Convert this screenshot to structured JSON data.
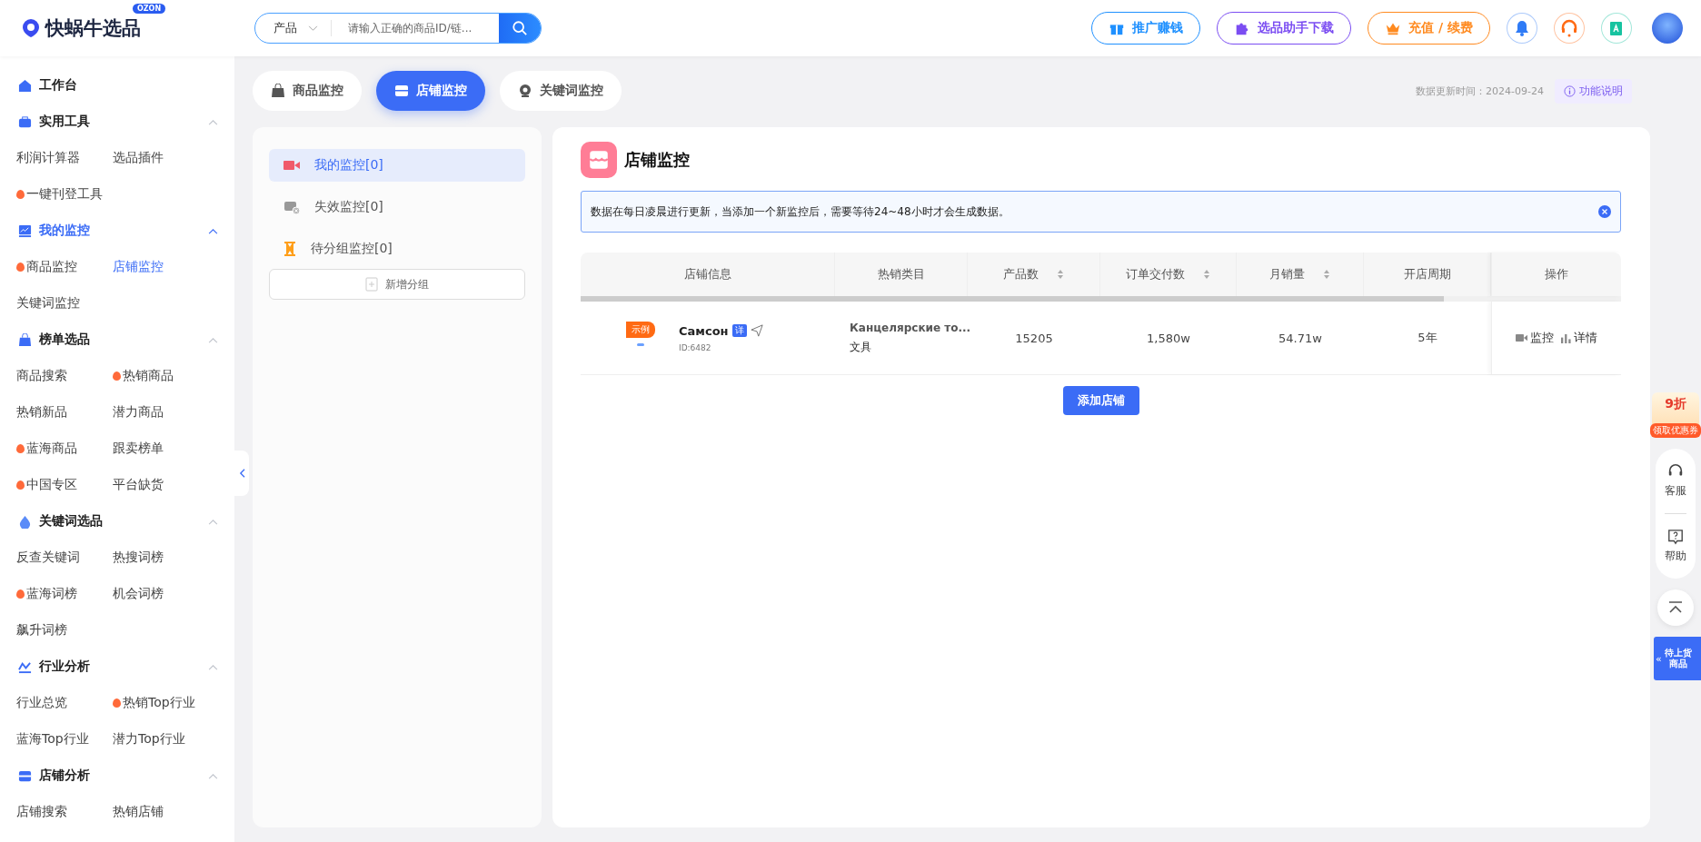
{
  "header": {
    "logo_text": "快蜗牛选品",
    "logo_badge": "OZON",
    "search": {
      "category": "产品",
      "placeholder": "请输入正确的商品ID/链..."
    },
    "buttons": [
      {
        "label": "推广赚钱",
        "kind": "gift",
        "color": "#1e90ff"
      },
      {
        "label": "选品助手下载",
        "kind": "puzzle",
        "color": "#7b4df2"
      },
      {
        "label": "充值 / 续费",
        "kind": "crown",
        "color": "#ff8a1f"
      }
    ],
    "icon_buttons": [
      {
        "kind": "bell",
        "color": "#2f7bf6"
      },
      {
        "kind": "headset",
        "color": "#ff6a13"
      },
      {
        "kind": "translate",
        "color": "#17c3a0"
      }
    ]
  },
  "sidebar": {
    "sections": [
      {
        "title": "工作台",
        "active": false,
        "expanded": false
      },
      {
        "title": "实用工具",
        "active": false,
        "expanded": true,
        "items": [
          {
            "label": "利润计算器",
            "hot": false,
            "selected": false
          },
          {
            "label": "选品插件",
            "hot": false,
            "selected": false
          },
          {
            "label": "一键刊登工具",
            "hot": true,
            "selected": false
          }
        ]
      },
      {
        "title": "我的监控",
        "active": true,
        "expanded": true,
        "items": [
          {
            "label": "商品监控",
            "hot": true,
            "selected": false
          },
          {
            "label": "店铺监控",
            "hot": false,
            "selected": true
          },
          {
            "label": "关键词监控",
            "hot": false,
            "selected": false
          }
        ]
      },
      {
        "title": "榜单选品",
        "active": false,
        "expanded": true,
        "items": [
          {
            "label": "商品搜索",
            "hot": false,
            "selected": false
          },
          {
            "label": "热销商品",
            "hot": true,
            "selected": false
          },
          {
            "label": "热销新品",
            "hot": false,
            "selected": false
          },
          {
            "label": "潜力商品",
            "hot": false,
            "selected": false
          },
          {
            "label": "蓝海商品",
            "hot": true,
            "selected": false
          },
          {
            "label": "跟卖榜单",
            "hot": false,
            "selected": false
          },
          {
            "label": "中国专区",
            "hot": true,
            "selected": false
          },
          {
            "label": "平台缺货",
            "hot": false,
            "selected": false
          }
        ]
      },
      {
        "title": "关键词选品",
        "active": false,
        "expanded": true,
        "items": [
          {
            "label": "反查关键词",
            "hot": false,
            "selected": false
          },
          {
            "label": "热搜词榜",
            "hot": false,
            "selected": false
          },
          {
            "label": "蓝海词榜",
            "hot": true,
            "selected": false
          },
          {
            "label": "机会词榜",
            "hot": false,
            "selected": false
          },
          {
            "label": "飙升词榜",
            "hot": false,
            "selected": false
          }
        ]
      },
      {
        "title": "行业分析",
        "active": false,
        "expanded": true,
        "items": [
          {
            "label": "行业总览",
            "hot": false,
            "selected": false
          },
          {
            "label": "热销Top行业",
            "hot": true,
            "selected": false
          },
          {
            "label": "蓝海Top行业",
            "hot": false,
            "selected": false
          },
          {
            "label": "潜力Top行业",
            "hot": false,
            "selected": false
          }
        ]
      },
      {
        "title": "店铺分析",
        "active": false,
        "expanded": true,
        "items": [
          {
            "label": "店铺搜索",
            "hot": false,
            "selected": false
          },
          {
            "label": "热销店铺",
            "hot": false,
            "selected": false
          }
        ]
      }
    ]
  },
  "tabs": [
    {
      "label": "商品监控",
      "selected": false
    },
    {
      "label": "店铺监控",
      "selected": true
    },
    {
      "label": "关键词监控",
      "selected": false
    }
  ],
  "update_time": "数据更新时间：2024-09-24",
  "help_link": "功能说明",
  "groups": [
    {
      "label": "我的监控[0]",
      "selected": true
    },
    {
      "label": "失效监控[0]",
      "selected": false
    },
    {
      "label": "待分组监控[0]",
      "selected": false
    }
  ],
  "add_group": "新增分组",
  "panel": {
    "title": "店铺监控",
    "notice": "数据在每日凌晨进行更新，当添加一个新监控后，需要等待24~48小时才会生成数据。",
    "columns": [
      {
        "label": "店铺信息",
        "sortable": false
      },
      {
        "label": "热销类目",
        "sortable": false
      },
      {
        "label": "产品数",
        "sortable": true
      },
      {
        "label": "订单交付数",
        "sortable": true
      },
      {
        "label": "月销量",
        "sortable": true
      },
      {
        "label": "开店周期",
        "sortable": false
      },
      {
        "label": "操作",
        "sortable": false
      }
    ],
    "rows": [
      {
        "badge": "示例",
        "name": "Самсон",
        "tag": "详",
        "id": "ID:6482",
        "category": "Канцелярские то...",
        "subcategory": "文具",
        "products": "15205",
        "orders": "1,580w",
        "monthly_sales": "54.71w",
        "store_age": "5年",
        "actions": [
          {
            "label": "监控",
            "kind": "monitor"
          },
          {
            "label": "详情",
            "kind": "detail"
          }
        ]
      }
    ],
    "add_button": "添加店铺"
  },
  "floating": {
    "promo": "9折",
    "promo_caption": "领取优惠券",
    "services": [
      {
        "label": "客服",
        "kind": "headset"
      },
      {
        "label": "帮助",
        "kind": "help"
      }
    ],
    "pending": [
      "待上货",
      "商品"
    ],
    "pending_arrow": "«"
  }
}
